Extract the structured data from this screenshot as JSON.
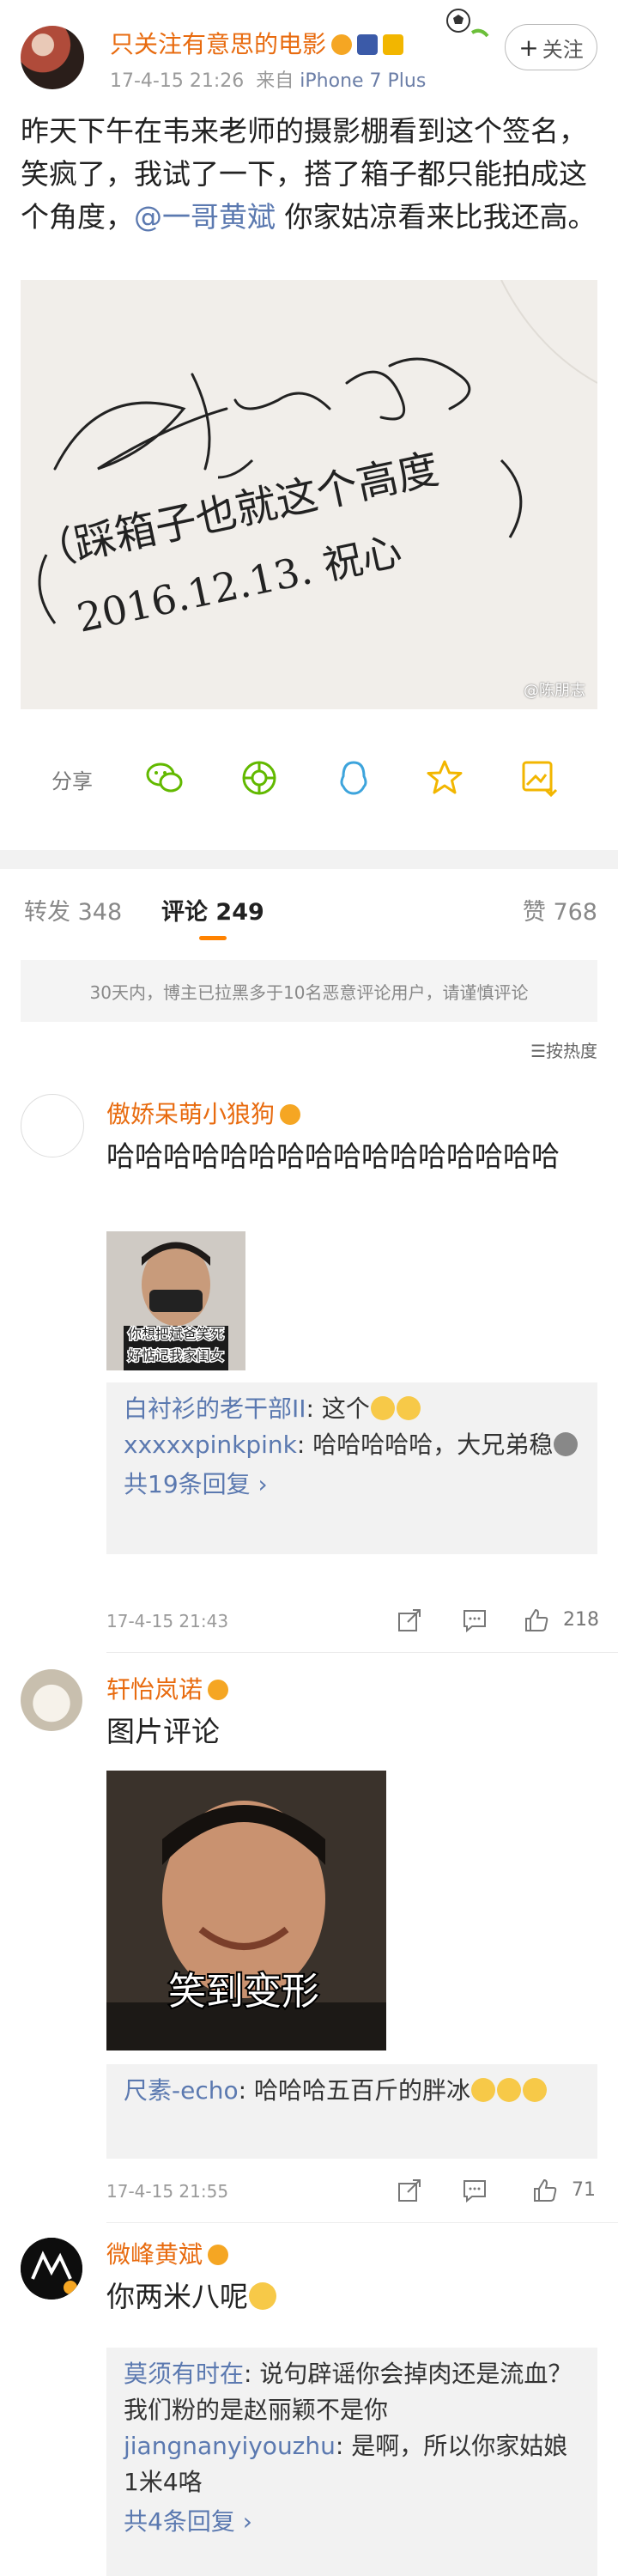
{
  "post": {
    "author": "只关注有意思的电影",
    "timestamp": "17-4-15 21:26",
    "source_prefix": "来自",
    "device": "iPhone 7 Plus",
    "follow_label": "关注",
    "text_part1": "昨天下午在韦来老师的摄影棚看到这个签名，笑疯了，我试了一下，搭了箱子都只能拍成这个角度，",
    "mention": "@一哥黄斌",
    "text_part2": " 你家姑凉看来比我还高。",
    "photo_watermark": "@陈朋志",
    "signature_line1": "（踩箱子也就这个高度",
    "signature_line2": "2016.12.13. 祝心",
    "share_label": "分享"
  },
  "icons": [
    "wechat-icon",
    "moments-icon",
    "qq-icon",
    "favorite-star-icon",
    "save-image-icon"
  ],
  "tabs": {
    "repost_label": "转发",
    "repost_count": "348",
    "comment_label": "评论",
    "comment_count": "249",
    "like_label": "赞",
    "like_count": "768"
  },
  "notice": "30天内，博主已拉黑多于10名恶意评论用户，请谨慎评论",
  "sort_label": "按热度",
  "comments": [
    {
      "author": "傲娇呆萌小狼狗",
      "text": "哈哈哈哈哈哈哈哈哈哈哈哈哈哈哈哈",
      "image_caption1": "你想把斌爸笑死",
      "image_caption2": "好惦记我家闺女",
      "replies": [
        {
          "name": "白衬衫的老干部II",
          "text": ": 这个"
        },
        {
          "name": "xxxxxpinkpink",
          "text": ": 哈哈哈哈哈，大兄弟稳"
        }
      ],
      "more": "共19条回复 ›",
      "time": "17-4-15 21:43",
      "likes": "218"
    },
    {
      "author": "轩怡岚诺",
      "text": "图片评论",
      "image_caption": "笑到变形",
      "replies": [
        {
          "name": "尺素-echo",
          "text": ": 哈哈哈五百斤的胖冰"
        }
      ],
      "time": "17-4-15 21:55",
      "likes": "71"
    },
    {
      "author": "微峰黄斌",
      "text": "你两米八呢",
      "replies": [
        {
          "name": "莫须有时在",
          "text": ": 说句辟谣你会掉肉还是流血？我们粉的是赵丽颖不是你"
        },
        {
          "name": "jiangnanyiyouzhu",
          "text": ": 是啊，所以你家姑娘1米4咯"
        }
      ],
      "more": "共4条回复 ›"
    }
  ],
  "colors": {
    "author_orange": "#e86b0f",
    "link_blue": "#5b79b0",
    "tab_accent": "#ff8200"
  }
}
